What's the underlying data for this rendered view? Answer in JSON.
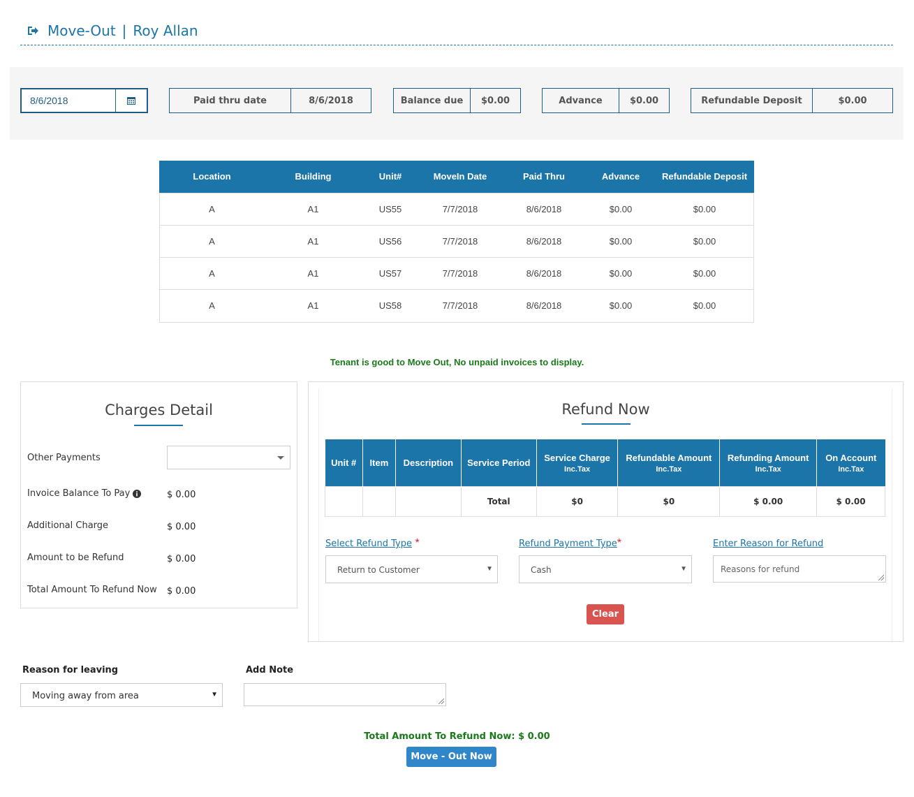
{
  "header": {
    "title": "Move-Out",
    "separator": "|",
    "tenant_name": "Roy Allan",
    "icon": "sign-out-icon"
  },
  "summary": {
    "date": "8/6/2018",
    "paid_thru_label": "Paid thru date",
    "paid_thru_value": "8/6/2018",
    "balance_due_label": "Balance due",
    "balance_due_value": "$0.00",
    "advance_label": "Advance",
    "advance_value": "$0.00",
    "refundable_deposit_label": "Refundable Deposit",
    "refundable_deposit_value": "$0.00"
  },
  "units_table": {
    "headers": [
      "Location",
      "Building",
      "Unit#",
      "MoveIn Date",
      "Paid Thru",
      "Advance",
      "Refundable Deposit"
    ],
    "rows": [
      [
        "A",
        "A1",
        "US55",
        "7/7/2018",
        "8/6/2018",
        "$0.00",
        "$0.00"
      ],
      [
        "A",
        "A1",
        "US56",
        "7/7/2018",
        "8/6/2018",
        "$0.00",
        "$0.00"
      ],
      [
        "A",
        "A1",
        "US57",
        "7/7/2018",
        "8/6/2018",
        "$0.00",
        "$0.00"
      ],
      [
        "A",
        "A1",
        "US58",
        "7/7/2018",
        "8/6/2018",
        "$0.00",
        "$0.00"
      ]
    ]
  },
  "status_message": "Tenant is good to Move Out, No unpaid invoices to display.",
  "charges": {
    "title": "Charges Detail",
    "other_payments_label": "Other Payments",
    "other_payments_value": "",
    "invoice_balance_label": "Invoice Balance To Pay",
    "invoice_balance_value": "$ 0.00",
    "additional_charge_label": "Additional Charge",
    "additional_charge_value": "$ 0.00",
    "amount_refund_label": "Amount to be Refund",
    "amount_refund_value": "$ 0.00",
    "total_refund_label": "Total Amount To Refund Now",
    "total_refund_value": "$ 0.00"
  },
  "refund": {
    "title": "Refund Now",
    "headers": {
      "unit": "Unit #",
      "item": "Item",
      "description": "Description",
      "service_period": "Service Period",
      "service_charge": "Service Charge",
      "refundable_amount": "Refundable Amount",
      "refunding_amount": "Refunding Amount",
      "on_account": "On Account",
      "inc_tax": "Inc.Tax"
    },
    "total_row": {
      "label": "Total",
      "service_charge": "$0",
      "refundable": "$0",
      "refunding": "$ 0.00",
      "on_account": "$ 0.00"
    },
    "refund_type_label": "Select Refund Type",
    "refund_type_value": "Return to Customer",
    "payment_type_label": "Refund Payment Type",
    "payment_type_value": "Cash",
    "reason_label": "Enter Reason for Refund",
    "reason_placeholder": "Reasons for refund",
    "required_mark": "*",
    "clear_label": "Clear"
  },
  "bottom": {
    "reason_leaving_label": "Reason for leaving",
    "reason_leaving_value": "Moving away from area",
    "add_note_label": "Add Note",
    "total_message": "Total Amount To Refund Now: $ 0.00",
    "move_out_label": "Move - Out Now"
  },
  "colors": {
    "primary": "#1b75a8",
    "success_text": "#1a7a1a",
    "danger": "#d9534f",
    "button": "#2f86c9"
  }
}
